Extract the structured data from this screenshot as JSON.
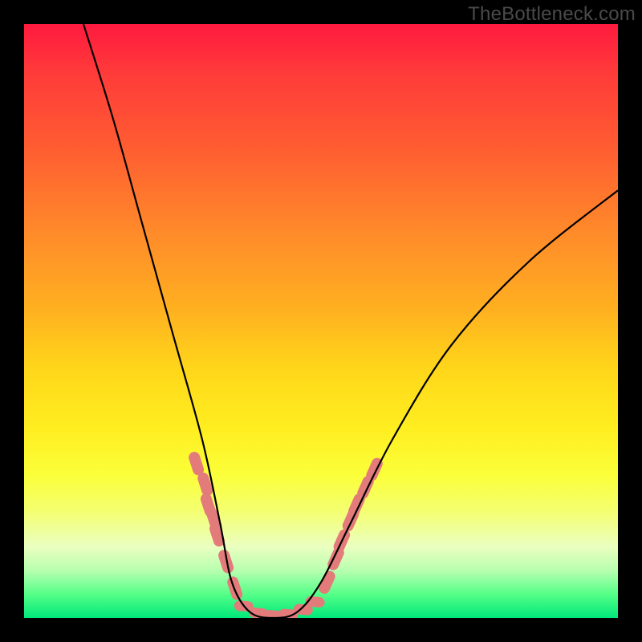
{
  "watermark": {
    "text": "TheBottleneck.com"
  },
  "chart_data": {
    "type": "line",
    "title": "",
    "xlabel": "",
    "ylabel": "",
    "xlim": [
      0,
      100
    ],
    "ylim": [
      0,
      100
    ],
    "series": [
      {
        "name": "bottleneck-curve",
        "points": [
          {
            "x": 10,
            "y": 100
          },
          {
            "x": 15,
            "y": 84
          },
          {
            "x": 20,
            "y": 66
          },
          {
            "x": 25,
            "y": 48
          },
          {
            "x": 30,
            "y": 30
          },
          {
            "x": 33,
            "y": 16
          },
          {
            "x": 35,
            "y": 6
          },
          {
            "x": 38,
            "y": 1
          },
          {
            "x": 42,
            "y": 0
          },
          {
            "x": 46,
            "y": 1
          },
          {
            "x": 50,
            "y": 6
          },
          {
            "x": 55,
            "y": 16
          },
          {
            "x": 62,
            "y": 30
          },
          {
            "x": 72,
            "y": 46
          },
          {
            "x": 85,
            "y": 60
          },
          {
            "x": 100,
            "y": 72
          }
        ]
      }
    ],
    "overlay_blobs": {
      "left_branch": [
        {
          "x": 29,
          "y": 26
        },
        {
          "x": 30.5,
          "y": 22.5
        },
        {
          "x": 31,
          "y": 19
        },
        {
          "x": 32,
          "y": 16.5
        },
        {
          "x": 32.5,
          "y": 14
        },
        {
          "x": 34,
          "y": 9.5
        },
        {
          "x": 35.5,
          "y": 5
        }
      ],
      "right_branch": [
        {
          "x": 51,
          "y": 6
        },
        {
          "x": 52.5,
          "y": 10
        },
        {
          "x": 53.5,
          "y": 13
        },
        {
          "x": 55,
          "y": 16.5
        },
        {
          "x": 56,
          "y": 19
        },
        {
          "x": 57.5,
          "y": 22
        },
        {
          "x": 59,
          "y": 25
        }
      ],
      "valley": [
        {
          "x": 37,
          "y": 2
        },
        {
          "x": 39.5,
          "y": 0.8
        },
        {
          "x": 42,
          "y": 0.4
        },
        {
          "x": 44.5,
          "y": 0.6
        },
        {
          "x": 47,
          "y": 1.4
        },
        {
          "x": 49,
          "y": 2.7
        }
      ]
    },
    "colors": {
      "curve_stroke": "#000000",
      "blob_fill": "#e37b7b",
      "gradient_top": "#ff1a3f",
      "gradient_bottom": "#00e87a",
      "frame": "#000000"
    }
  }
}
